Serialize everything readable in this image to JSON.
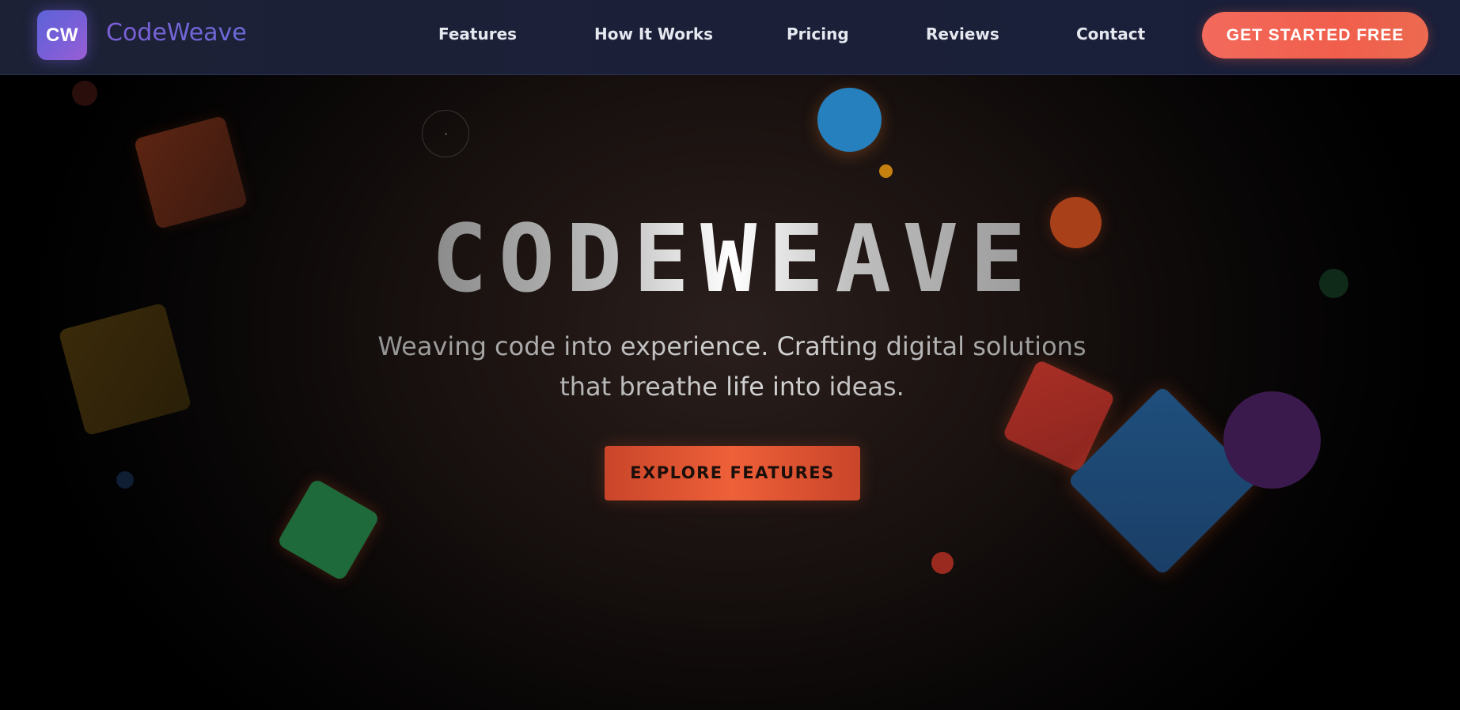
{
  "header": {
    "logo_text": "CW",
    "brand_name": "CodeWeave",
    "nav": [
      {
        "label": "Features"
      },
      {
        "label": "How It Works"
      },
      {
        "label": "Pricing"
      },
      {
        "label": "Reviews"
      },
      {
        "label": "Contact"
      }
    ],
    "cta_label": "GET STARTED FREE"
  },
  "hero": {
    "title": "CODEWEAVE",
    "subtitle_line1": "Weaving code into experience. Crafting digital solutions",
    "subtitle_line2": "that breathe life into ideas.",
    "button_label": "EXPLORE FEATURES"
  },
  "colors": {
    "accent": "#f15e4c",
    "brand_gradient_start": "#5d63d8",
    "brand_gradient_end": "#9a5ed3",
    "nav_background": "#1d2136",
    "hero_background": "#000000"
  }
}
